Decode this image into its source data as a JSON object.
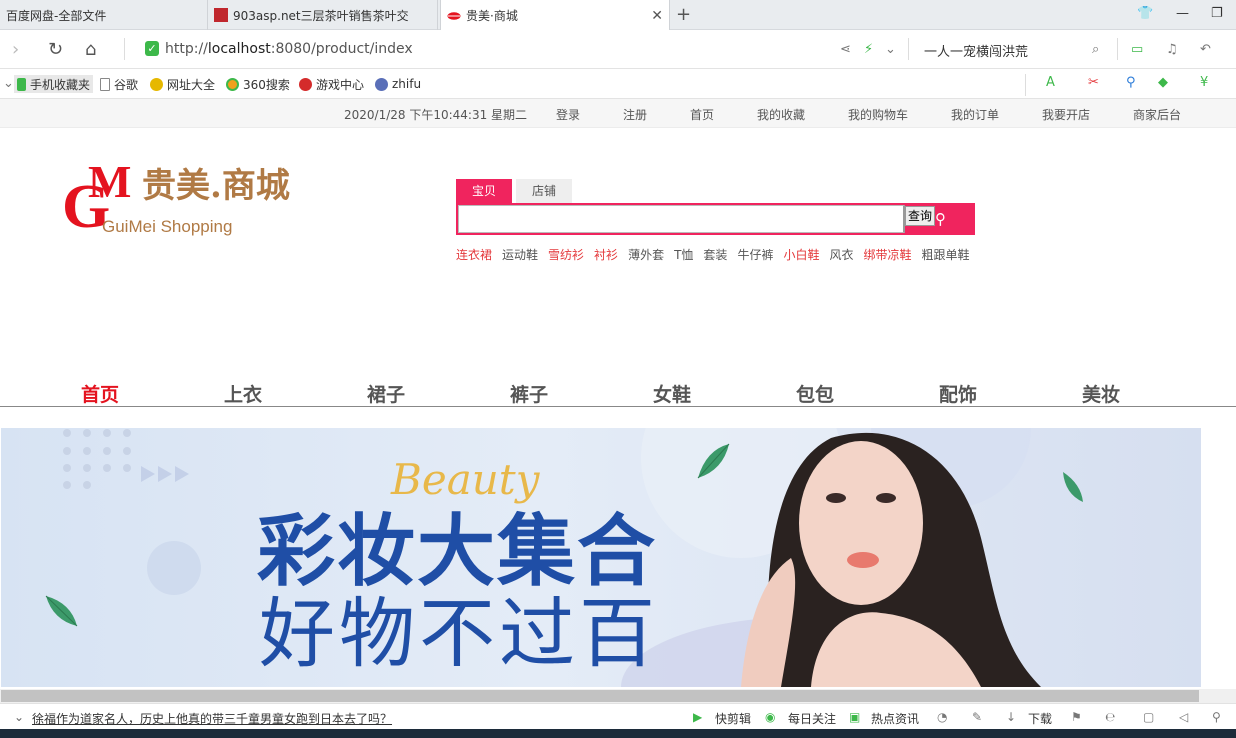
{
  "browser": {
    "tabs": [
      {
        "title": "百度网盘-全部文件",
        "active": false
      },
      {
        "title": "903asp.net三层茶叶销售茶叶交",
        "active": false
      },
      {
        "title": "贵美·商城",
        "active": true
      }
    ],
    "new_tab": "+",
    "url_prefix": "http://",
    "url_host": "localhost",
    "url_path": ":8080/product/index",
    "search_text": "一人一宠横闯洪荒",
    "bookmarks": [
      "手机收藏夹",
      "谷歌",
      "网址大全",
      "360搜索",
      "游戏中心",
      "zhifu"
    ]
  },
  "top_info": {
    "datetime": "2020/1/28 下午10:44:31 星期二",
    "links": [
      "登录",
      "注册",
      "首页",
      "我的收藏",
      "我的购物车",
      "我的订单",
      "我要开店",
      "商家后台"
    ]
  },
  "logo": {
    "title": "贵美.商城",
    "subtitle": "GuiMei Shopping",
    "mark": "GM"
  },
  "search": {
    "tabs": [
      "宝贝",
      "店铺"
    ],
    "input_value": "",
    "button_label": "查询",
    "hot_words": [
      {
        "text": "连衣裙",
        "red": true
      },
      {
        "text": "运动鞋",
        "red": false
      },
      {
        "text": "雪纺衫",
        "red": true
      },
      {
        "text": "衬衫",
        "red": true
      },
      {
        "text": "薄外套",
        "red": false
      },
      {
        "text": "T恤",
        "red": false
      },
      {
        "text": "套装",
        "red": false
      },
      {
        "text": "牛仔裤",
        "red": false
      },
      {
        "text": "小白鞋",
        "red": true
      },
      {
        "text": "风衣",
        "red": false
      },
      {
        "text": "绑带凉鞋",
        "red": true
      },
      {
        "text": "粗跟单鞋",
        "red": false
      }
    ]
  },
  "categories": [
    "首页",
    "上衣",
    "裙子",
    "裤子",
    "女鞋",
    "包包",
    "配饰",
    "美妆"
  ],
  "banner": {
    "script_text": "Beauty",
    "headline": "彩妆大集合",
    "subline": "好物不过百"
  },
  "statusbar": {
    "news": "徐福作为道家名人，历史上他真的带三千童男童女跑到日本去了吗？",
    "items": [
      "快剪辑",
      "每日关注",
      "热点资讯",
      "下载"
    ]
  },
  "colors": {
    "accent": "#f0245e",
    "nav_active": "#e4131f",
    "banner_blue": "#1f4ea6"
  }
}
